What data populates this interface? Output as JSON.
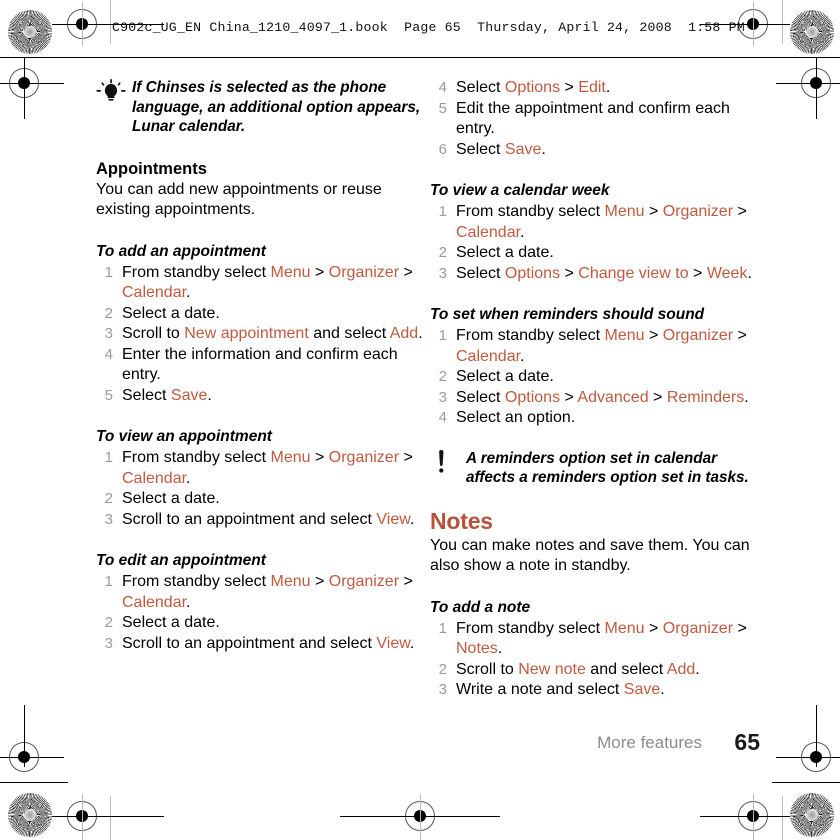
{
  "print_header": {
    "text": "C902c_UG_EN China_1210_4097_1.book  Page 65  Thursday, April 24, 2008  1:58 PM"
  },
  "colors": {
    "accent": "#bf5a3f",
    "heading": "#b8513a",
    "step_number": "#9b9b9b",
    "footer_label": "#8c8c8c",
    "body_text": "#000000"
  },
  "left_column": {
    "tip": {
      "icon": "lightbulb-icon",
      "text": "If Chinses is selected as the phone language, an additional option appears, Lunar calendar."
    },
    "section_heading": "Appointments",
    "section_body": "You can add new appointments or reuse existing appointments.",
    "procedures": [
      {
        "title": "To add an appointment",
        "steps": [
          [
            {
              "t": "From standby select ",
              "a": false
            },
            {
              "t": "Menu",
              "a": true
            },
            {
              "t": " > ",
              "a": false
            },
            {
              "t": "Organizer",
              "a": true
            },
            {
              "t": " > ",
              "a": false
            },
            {
              "t": "Calendar",
              "a": true
            },
            {
              "t": ".",
              "a": false
            }
          ],
          [
            {
              "t": "Select a date.",
              "a": false
            }
          ],
          [
            {
              "t": "Scroll to ",
              "a": false
            },
            {
              "t": "New appointment",
              "a": true
            },
            {
              "t": " and select ",
              "a": false
            },
            {
              "t": "Add",
              "a": true
            },
            {
              "t": ".",
              "a": false
            }
          ],
          [
            {
              "t": "Enter the information and confirm each entry.",
              "a": false
            }
          ],
          [
            {
              "t": "Select ",
              "a": false
            },
            {
              "t": "Save",
              "a": true
            },
            {
              "t": ".",
              "a": false
            }
          ]
        ]
      },
      {
        "title": "To view an appointment",
        "steps": [
          [
            {
              "t": "From standby select ",
              "a": false
            },
            {
              "t": "Menu",
              "a": true
            },
            {
              "t": " > ",
              "a": false
            },
            {
              "t": "Organizer",
              "a": true
            },
            {
              "t": " > ",
              "a": false
            },
            {
              "t": "Calendar",
              "a": true
            },
            {
              "t": ".",
              "a": false
            }
          ],
          [
            {
              "t": "Select a date.",
              "a": false
            }
          ],
          [
            {
              "t": "Scroll to an appointment and select ",
              "a": false
            },
            {
              "t": "View",
              "a": true
            },
            {
              "t": ".",
              "a": false
            }
          ]
        ]
      },
      {
        "title": "To edit an appointment",
        "steps": [
          [
            {
              "t": "From standby select ",
              "a": false
            },
            {
              "t": "Menu",
              "a": true
            },
            {
              "t": " > ",
              "a": false
            },
            {
              "t": "Organizer",
              "a": true
            },
            {
              "t": " > ",
              "a": false
            },
            {
              "t": "Calendar",
              "a": true
            },
            {
              "t": ".",
              "a": false
            }
          ],
          [
            {
              "t": "Select a date.",
              "a": false
            }
          ],
          [
            {
              "t": "Scroll to an appointment and select ",
              "a": false
            },
            {
              "t": "View",
              "a": true
            },
            {
              "t": ".",
              "a": false
            }
          ]
        ]
      }
    ]
  },
  "right_column": {
    "continued_steps": {
      "start_number": 4,
      "steps": [
        [
          {
            "t": "Select ",
            "a": false
          },
          {
            "t": "Options",
            "a": true
          },
          {
            "t": " > ",
            "a": false
          },
          {
            "t": "Edit",
            "a": true
          },
          {
            "t": ".",
            "a": false
          }
        ],
        [
          {
            "t": "Edit the appointment and confirm each entry.",
            "a": false
          }
        ],
        [
          {
            "t": "Select ",
            "a": false
          },
          {
            "t": "Save",
            "a": true
          },
          {
            "t": ".",
            "a": false
          }
        ]
      ]
    },
    "procedures": [
      {
        "title": "To view a calendar week",
        "steps": [
          [
            {
              "t": "From standby select ",
              "a": false
            },
            {
              "t": "Menu",
              "a": true
            },
            {
              "t": " > ",
              "a": false
            },
            {
              "t": "Organizer",
              "a": true
            },
            {
              "t": " > ",
              "a": false
            },
            {
              "t": "Calendar",
              "a": true
            },
            {
              "t": ".",
              "a": false
            }
          ],
          [
            {
              "t": "Select a date.",
              "a": false
            }
          ],
          [
            {
              "t": "Select ",
              "a": false
            },
            {
              "t": "Options",
              "a": true
            },
            {
              "t": " > ",
              "a": false
            },
            {
              "t": "Change view to",
              "a": true
            },
            {
              "t": " > ",
              "a": false
            },
            {
              "t": "Week",
              "a": true
            },
            {
              "t": ".",
              "a": false
            }
          ]
        ]
      },
      {
        "title": "To set when reminders should sound",
        "steps": [
          [
            {
              "t": "From standby select ",
              "a": false
            },
            {
              "t": "Menu",
              "a": true
            },
            {
              "t": " > ",
              "a": false
            },
            {
              "t": "Organizer",
              "a": true
            },
            {
              "t": " > ",
              "a": false
            },
            {
              "t": "Calendar",
              "a": true
            },
            {
              "t": ".",
              "a": false
            }
          ],
          [
            {
              "t": "Select a date.",
              "a": false
            }
          ],
          [
            {
              "t": "Select ",
              "a": false
            },
            {
              "t": "Options",
              "a": true
            },
            {
              "t": " > ",
              "a": false
            },
            {
              "t": "Advanced",
              "a": true
            },
            {
              "t": " > ",
              "a": false
            },
            {
              "t": "Reminders",
              "a": true
            },
            {
              "t": ".",
              "a": false
            }
          ],
          [
            {
              "t": "Select an option.",
              "a": false
            }
          ]
        ]
      }
    ],
    "note": {
      "icon": "exclamation-icon",
      "text": "A reminders option set in calendar affects a reminders option set in tasks."
    },
    "notes_section": {
      "heading": "Notes",
      "body": "You can make notes and save them. You can also show a note in standby.",
      "procedure": {
        "title": "To add a note",
        "steps": [
          [
            {
              "t": "From standby select ",
              "a": false
            },
            {
              "t": "Menu",
              "a": true
            },
            {
              "t": " > ",
              "a": false
            },
            {
              "t": "Organizer",
              "a": true
            },
            {
              "t": " > ",
              "a": false
            },
            {
              "t": "Notes",
              "a": true
            },
            {
              "t": ".",
              "a": false
            }
          ],
          [
            {
              "t": "Scroll to ",
              "a": false
            },
            {
              "t": "New note",
              "a": true
            },
            {
              "t": " and select ",
              "a": false
            },
            {
              "t": "Add",
              "a": true
            },
            {
              "t": ".",
              "a": false
            }
          ],
          [
            {
              "t": "Write a note and select ",
              "a": false
            },
            {
              "t": "Save",
              "a": true
            },
            {
              "t": ".",
              "a": false
            }
          ]
        ]
      }
    }
  },
  "footer": {
    "chapter": "More features",
    "page_number": "65"
  }
}
